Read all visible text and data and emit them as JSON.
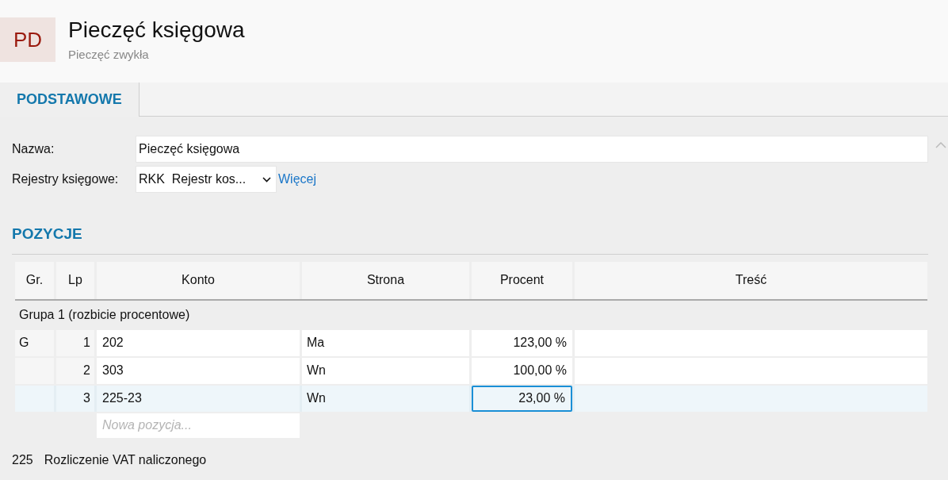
{
  "header": {
    "avatar": "PD",
    "title": "Pieczęć księgowa",
    "subtitle": "Pieczęć zwykła"
  },
  "tabs": [
    {
      "label": "PODSTAWOWE",
      "selected": true
    }
  ],
  "form": {
    "name_label": "Nazwa:",
    "name_value": "Pieczęć księgowa",
    "registers_label": "Rejestry księgowe:",
    "registers_value": "RKK  Rejestr kos...",
    "more_link": "Więcej"
  },
  "section_title": "POZYCJE",
  "table": {
    "columns": [
      "Gr.",
      "Lp",
      "Konto",
      "Strona",
      "Procent",
      "Treść"
    ],
    "group_label": "Grupa 1 (rozbicie procentowe)",
    "rows": [
      {
        "gr": "G",
        "lp": "1",
        "konto": "202",
        "strona": "Ma",
        "procent": "123,00 %",
        "selected": false,
        "procent_focused": false
      },
      {
        "gr": "",
        "lp": "2",
        "konto": "303",
        "strona": "Wn",
        "procent": "100,00 %",
        "selected": false,
        "procent_focused": false
      },
      {
        "gr": "",
        "lp": "3",
        "konto": "225-23",
        "strona": "Wn",
        "procent": "23,00 %",
        "selected": true,
        "procent_focused": true
      }
    ],
    "new_row_placeholder": "Nowa pozycja..."
  },
  "footer": {
    "account": "225",
    "account_name": "Rozliczenie VAT naliczonego"
  }
}
